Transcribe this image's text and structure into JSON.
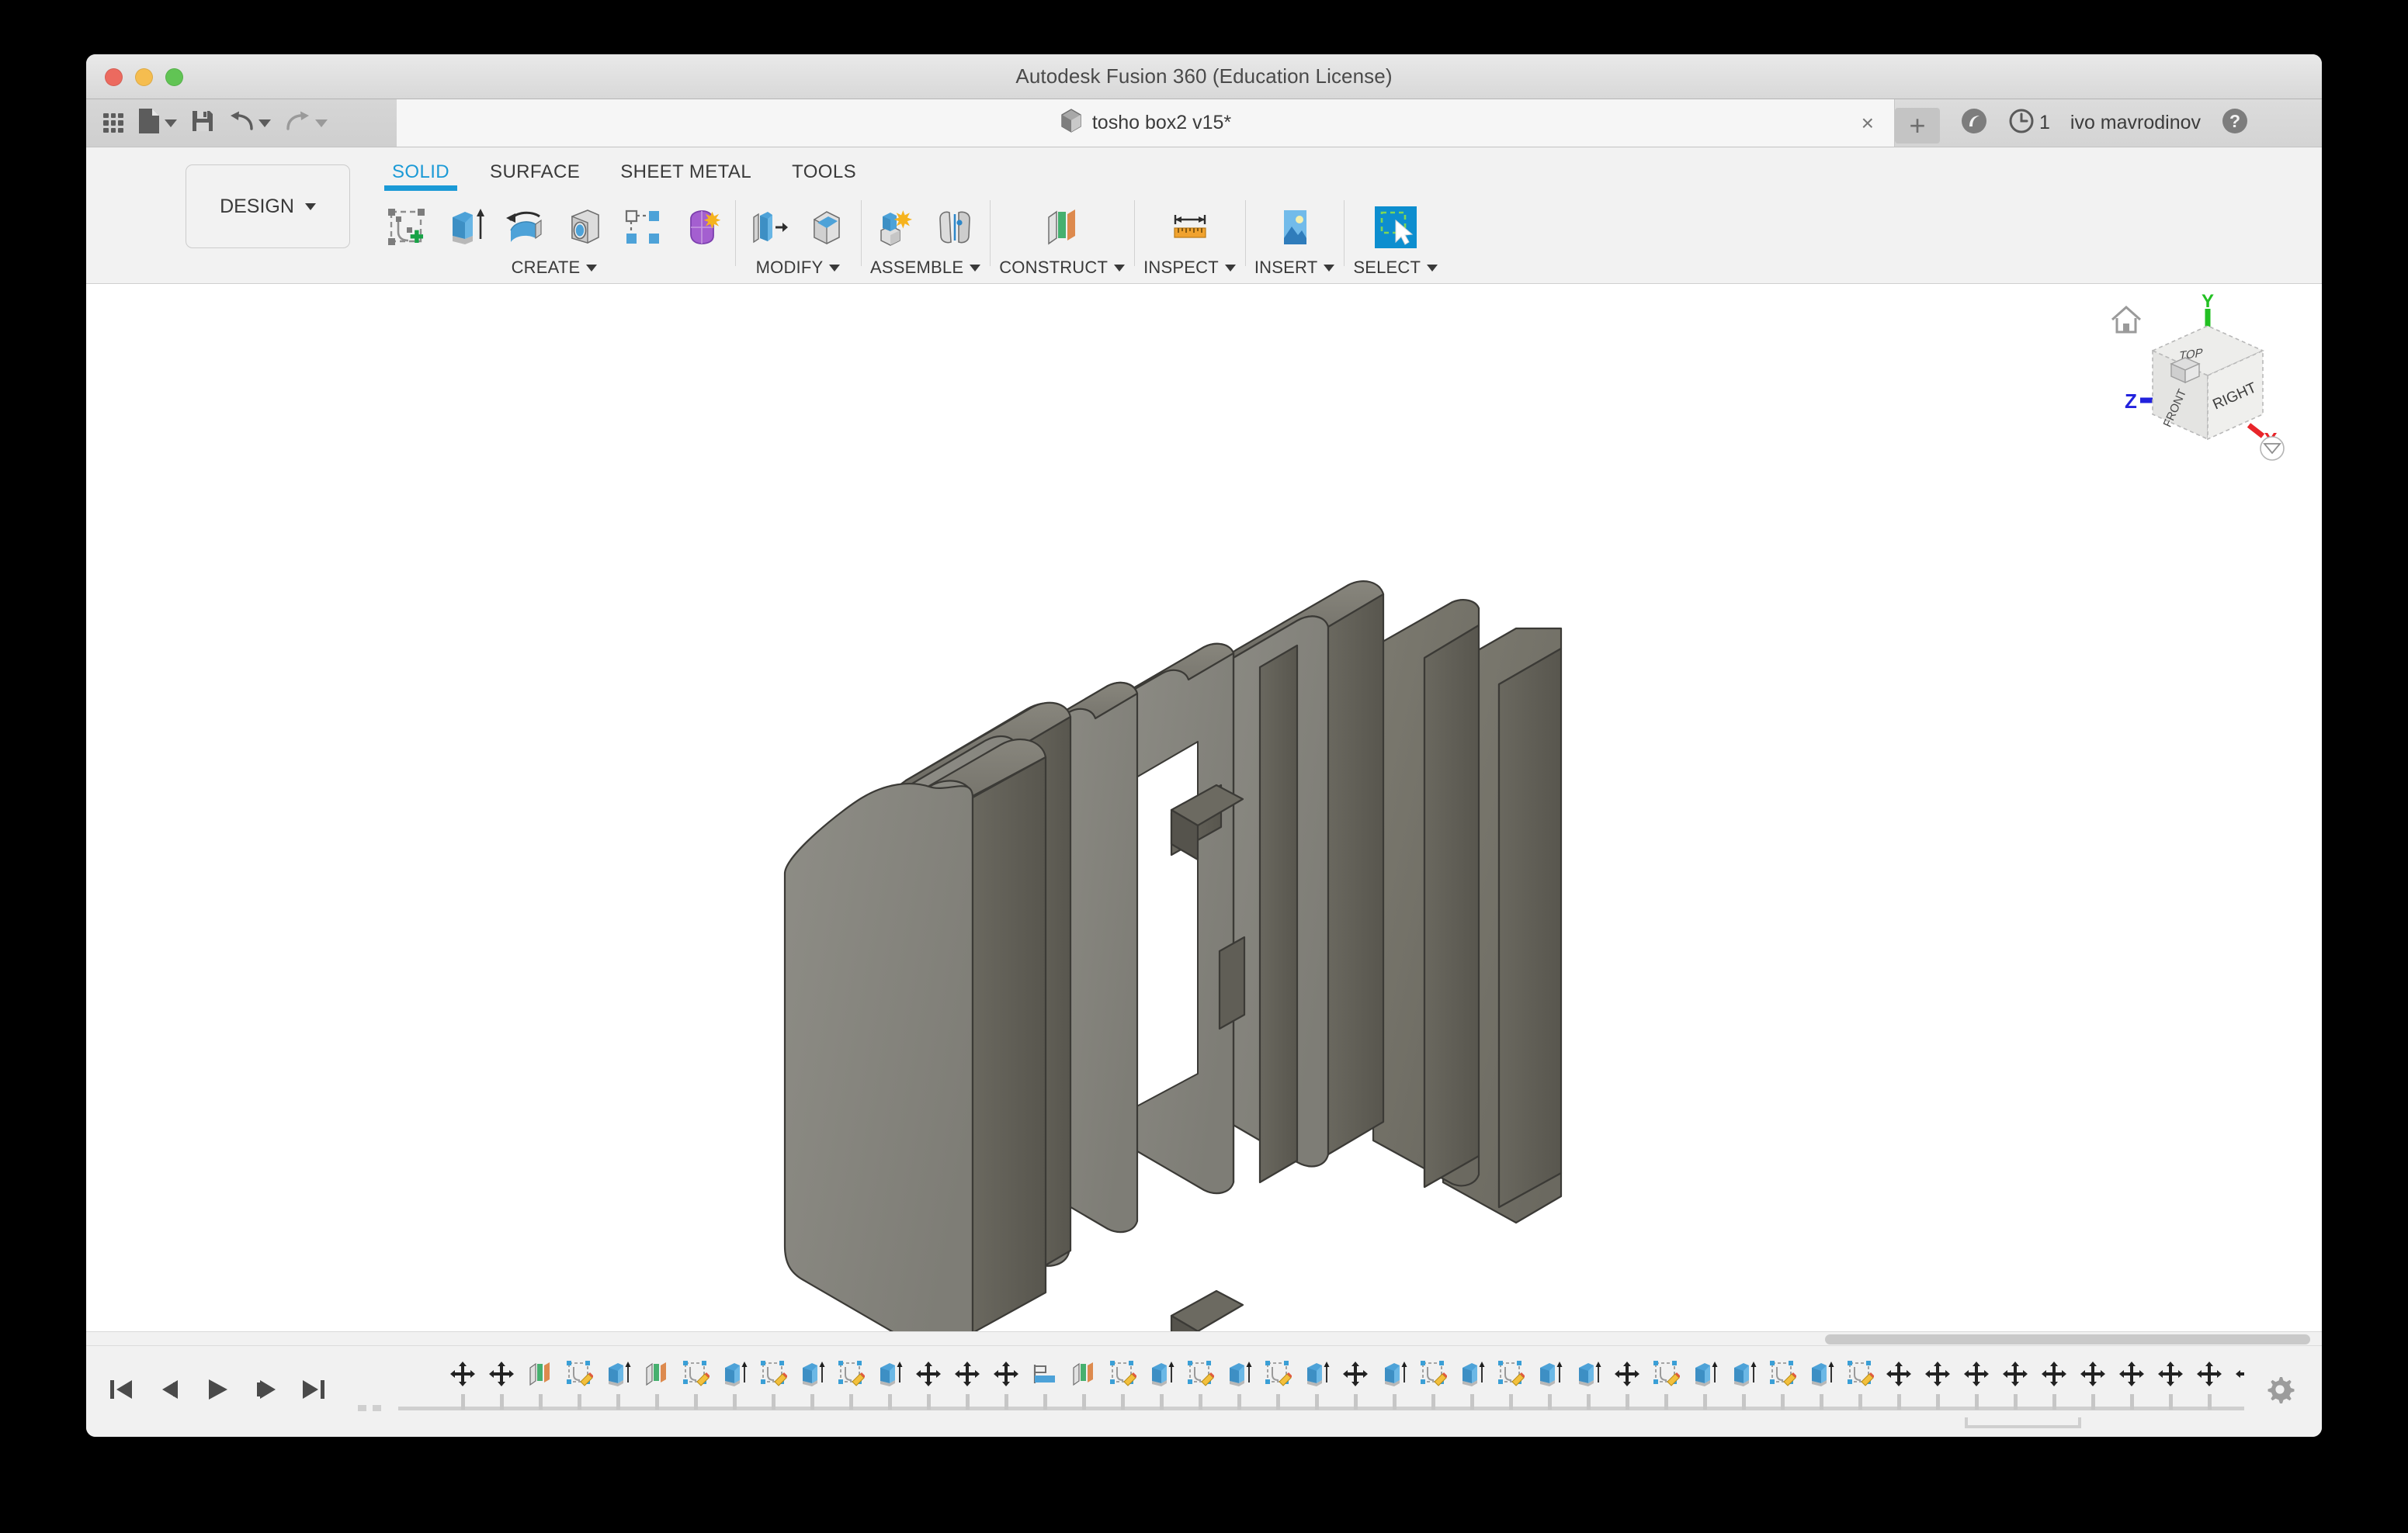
{
  "window": {
    "title": "Autodesk Fusion 360 (Education License)",
    "traffic_lights": [
      "close",
      "minimize",
      "maximize"
    ]
  },
  "quick_access": {
    "items": [
      {
        "name": "app-grid",
        "icon": "grid-icon",
        "label": "Show Data Panel"
      },
      {
        "name": "file-menu",
        "icon": "file-icon",
        "label": "File",
        "has_dropdown": true
      },
      {
        "name": "save",
        "icon": "save-icon",
        "label": "Save"
      },
      {
        "name": "undo",
        "icon": "undo-icon",
        "label": "Undo",
        "has_dropdown": true
      },
      {
        "name": "redo",
        "icon": "redo-icon",
        "label": "Redo",
        "has_dropdown": true
      }
    ]
  },
  "document_tab": {
    "icon": "cube-icon",
    "title": "tosho box2 v15*",
    "close_label": "×"
  },
  "tab_controls": {
    "new_tab_label": "+",
    "extensions_icon": "extension-icon",
    "job_status_icon": "clock-icon",
    "job_count": "1",
    "username": "ivo mavrodinov",
    "help_icon": "help-icon"
  },
  "ribbon": {
    "design_button": "DESIGN",
    "tabs": [
      {
        "label": "SOLID",
        "active": true
      },
      {
        "label": "SURFACE",
        "active": false
      },
      {
        "label": "SHEET METAL",
        "active": false
      },
      {
        "label": "TOOLS",
        "active": false
      }
    ],
    "panels": [
      {
        "label": "CREATE",
        "name": "create-panel",
        "tools": [
          {
            "name": "create-sketch-button",
            "icon": "sketch-plus-icon"
          },
          {
            "name": "extrude-button",
            "icon": "extrude-icon"
          },
          {
            "name": "revolve-button",
            "icon": "revolve-icon"
          },
          {
            "name": "hole-button",
            "icon": "hole-icon"
          },
          {
            "name": "pattern-button",
            "icon": "pattern-icon"
          },
          {
            "name": "create-form-button",
            "icon": "form-sculpt-icon"
          }
        ]
      },
      {
        "label": "MODIFY",
        "name": "modify-panel",
        "tools": [
          {
            "name": "press-pull-button",
            "icon": "press-pull-icon"
          },
          {
            "name": "fillet-button",
            "icon": "fillet-icon"
          }
        ]
      },
      {
        "label": "ASSEMBLE",
        "name": "assemble-panel",
        "tools": [
          {
            "name": "new-component-button",
            "icon": "new-component-icon"
          },
          {
            "name": "joint-button",
            "icon": "joint-icon"
          }
        ]
      },
      {
        "label": "CONSTRUCT",
        "name": "construct-panel",
        "tools": [
          {
            "name": "offset-plane-button",
            "icon": "offset-plane-icon"
          }
        ]
      },
      {
        "label": "INSPECT",
        "name": "inspect-panel",
        "tools": [
          {
            "name": "measure-button",
            "icon": "measure-ruler-icon"
          }
        ]
      },
      {
        "label": "INSERT",
        "name": "insert-panel",
        "tools": [
          {
            "name": "insert-image-button",
            "icon": "image-icon"
          }
        ]
      },
      {
        "label": "SELECT",
        "name": "select-panel",
        "tools": [
          {
            "name": "select-tool-button",
            "icon": "select-cursor-icon",
            "active": true
          }
        ]
      }
    ]
  },
  "viewport": {
    "background_color": "#ffffff",
    "model_name": "tosho box2",
    "model_description": "Exploded assembly of stacked rounded-rectangle enclosure plates and frames",
    "model_colors": {
      "face_light": "#8c8c85",
      "face_mid": "#77756c",
      "face_dark": "#5f5e57",
      "edge": "#3c3b37"
    },
    "navigation": {
      "home_icon": "home-icon",
      "cube_front_face": "RIGHT",
      "cube_left_face": "FRONT",
      "cube_top_face": "TOP",
      "axis_x": "X",
      "axis_y": "Y",
      "axis_z": "Z",
      "axis_x_color": "#e8252a",
      "axis_y_color": "#22c022",
      "axis_z_color": "#2222dd",
      "dropdown_icon": "view-dropdown-icon"
    }
  },
  "timeline": {
    "transport": [
      {
        "name": "go-to-beginning",
        "icon": "skip-start-icon"
      },
      {
        "name": "step-back",
        "icon": "step-back-icon"
      },
      {
        "name": "play",
        "icon": "play-icon"
      },
      {
        "name": "step-forward",
        "icon": "step-forward-icon"
      },
      {
        "name": "go-to-end",
        "icon": "skip-end-icon"
      }
    ],
    "settings_icon": "gear-icon",
    "playhead_position_index": 47,
    "features": [
      {
        "type": "move",
        "icon": "move-icon"
      },
      {
        "type": "move",
        "icon": "move-icon"
      },
      {
        "type": "plane",
        "icon": "construct-plane-icon"
      },
      {
        "type": "sketch",
        "icon": "sketch-icon"
      },
      {
        "type": "extrude",
        "icon": "extrude-icon"
      },
      {
        "type": "plane",
        "icon": "construct-plane-icon"
      },
      {
        "type": "sketch",
        "icon": "sketch-icon"
      },
      {
        "type": "extrude",
        "icon": "extrude-icon"
      },
      {
        "type": "sketch",
        "icon": "sketch-icon"
      },
      {
        "type": "extrude",
        "icon": "extrude-icon"
      },
      {
        "type": "sketch",
        "icon": "sketch-icon"
      },
      {
        "type": "extrude",
        "icon": "extrude-icon"
      },
      {
        "type": "move",
        "icon": "move-icon"
      },
      {
        "type": "move",
        "icon": "move-icon"
      },
      {
        "type": "move",
        "icon": "move-icon"
      },
      {
        "type": "align",
        "icon": "align-icon"
      },
      {
        "type": "plane",
        "icon": "construct-plane-icon"
      },
      {
        "type": "sketch",
        "icon": "sketch-icon"
      },
      {
        "type": "extrude",
        "icon": "extrude-icon"
      },
      {
        "type": "sketch",
        "icon": "sketch-icon"
      },
      {
        "type": "extrude",
        "icon": "extrude-icon"
      },
      {
        "type": "sketch",
        "icon": "sketch-icon"
      },
      {
        "type": "extrude",
        "icon": "extrude-icon"
      },
      {
        "type": "move",
        "icon": "move-icon"
      },
      {
        "type": "extrude",
        "icon": "extrude-icon"
      },
      {
        "type": "sketch",
        "icon": "sketch-icon"
      },
      {
        "type": "extrude",
        "icon": "extrude-icon"
      },
      {
        "type": "sketch",
        "icon": "sketch-icon"
      },
      {
        "type": "extrude",
        "icon": "extrude-icon"
      },
      {
        "type": "extrude",
        "icon": "extrude-icon"
      },
      {
        "type": "move",
        "icon": "move-icon"
      },
      {
        "type": "sketch",
        "icon": "sketch-icon"
      },
      {
        "type": "extrude",
        "icon": "extrude-icon"
      },
      {
        "type": "extrude",
        "icon": "extrude-icon"
      },
      {
        "type": "sketch",
        "icon": "sketch-icon"
      },
      {
        "type": "extrude",
        "icon": "extrude-icon"
      },
      {
        "type": "sketch",
        "icon": "sketch-icon"
      },
      {
        "type": "move",
        "icon": "move-icon"
      },
      {
        "type": "move",
        "icon": "move-icon"
      },
      {
        "type": "move",
        "icon": "move-icon"
      },
      {
        "type": "move",
        "icon": "move-icon"
      },
      {
        "type": "move",
        "icon": "move-icon"
      },
      {
        "type": "move",
        "icon": "move-icon"
      },
      {
        "type": "move",
        "icon": "move-icon"
      },
      {
        "type": "move",
        "icon": "move-icon"
      },
      {
        "type": "move",
        "icon": "move-icon"
      },
      {
        "type": "move",
        "icon": "move-icon"
      },
      {
        "type": "move",
        "icon": "move-icon"
      }
    ]
  }
}
